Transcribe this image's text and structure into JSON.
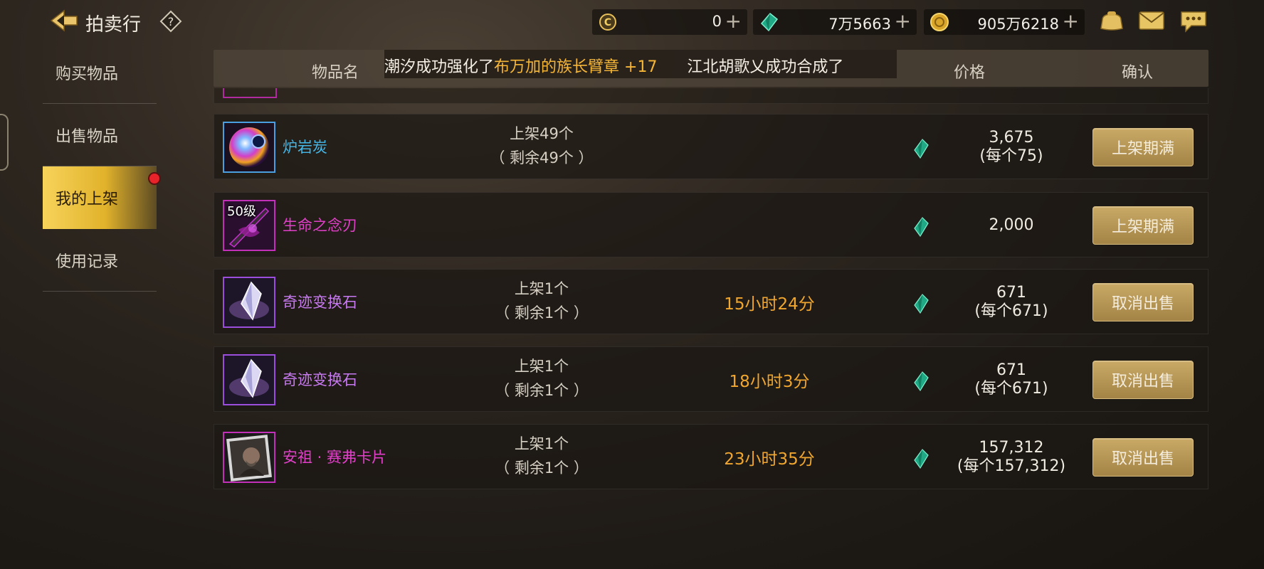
{
  "header": {
    "title": "拍卖行",
    "currencies": [
      {
        "icon": "coupon-c-icon",
        "value": "0"
      },
      {
        "icon": "green-gem-icon",
        "value": "7万5663"
      },
      {
        "icon": "gold-coin-icon",
        "value": "905万6218"
      }
    ],
    "plus": "+"
  },
  "sidebar": {
    "items": [
      {
        "label": "购买物品",
        "selected": false
      },
      {
        "label": "出售物品",
        "selected": false
      },
      {
        "label": "我的上架",
        "selected": true,
        "badge": "red-dot"
      },
      {
        "label": "使用记录",
        "selected": false
      }
    ]
  },
  "table": {
    "headers": {
      "name": "物品名",
      "price": "价格",
      "confirm": "确认"
    },
    "ticker": {
      "part1": "潮汐成功强化了",
      "highlight": "布万加的族长臂章 +17",
      "part2": "江北胡歌乂成功合成了"
    },
    "rows": [
      {
        "name": "炉岩炭",
        "name_color": "#45b8e8",
        "icon": "lava-orb-icon",
        "listed": "上架49个",
        "remaining": "（ 剩余49个 ）",
        "time": "",
        "price": "3,675",
        "unit_price": "(每个75)",
        "button": "上架期满"
      },
      {
        "name": "生命之念刃",
        "name_color": "#e040c8",
        "icon": "dark-blade-icon",
        "level": "50级",
        "listed": "",
        "remaining": "",
        "time": "",
        "price": "2,000",
        "unit_price": "",
        "button": "上架期满"
      },
      {
        "name": "奇迹变换石",
        "name_color": "#c779f0",
        "icon": "crystal-stone-icon",
        "listed": "上架1个",
        "remaining": "（ 剩余1个 ）",
        "time": "15小时24分",
        "price": "671",
        "unit_price": "(每个671)",
        "button": "取消出售"
      },
      {
        "name": "奇迹变换石",
        "name_color": "#c779f0",
        "icon": "crystal-stone-icon",
        "listed": "上架1个",
        "remaining": "（ 剩余1个 ）",
        "time": "18小时3分",
        "price": "671",
        "unit_price": "(每个671)",
        "button": "取消出售"
      },
      {
        "name": "安祖 · 赛弗卡片",
        "name_color": "#e040c8",
        "icon": "portrait-card-icon",
        "listed": "上架1个",
        "remaining": "（ 剩余1个 ）",
        "time": "23小时35分",
        "price": "157,312",
        "unit_price": "(每个157,312)",
        "button": "取消出售"
      }
    ]
  }
}
